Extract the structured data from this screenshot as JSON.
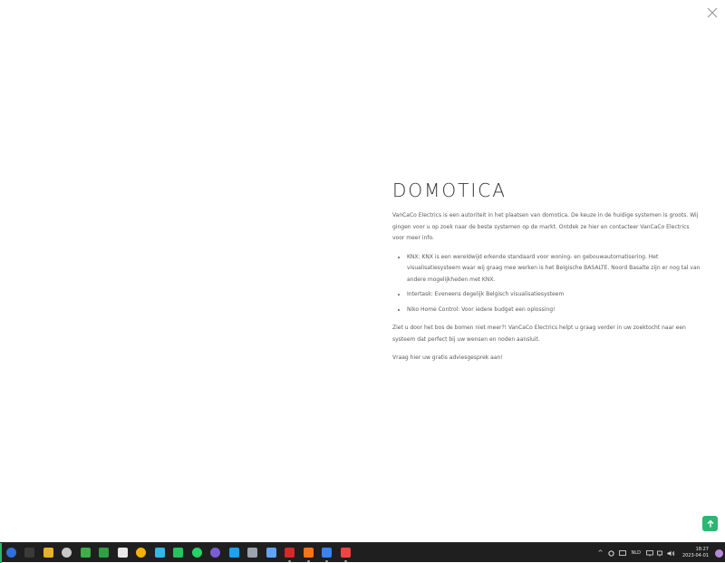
{
  "article": {
    "title": "DOMOTICA",
    "intro": "VanCaCo Electrics is een autoriteit in het plaatsen van domotica. De keuze in de huidige systemen is groots. Wij gingen voor u op zoek naar de beste systemen op de markt. Ontdek ze hier en contacteer VanCaCo Electrics voor meer info.",
    "bullets": [
      "KNX: KNX is een wereldwijd erkende standaard voor woning- en gebouwautomatisering. Het visualisatiesysteem waar wij graag mee werken is het Belgische BASALTE. Noord Basalte zijn er nog tal van andere mogelijkheden met KNX.",
      "Intertask: Eveneens degelijk Belgisch visualisatiesysteem",
      "Niko Home Control: Voor iedere budget een oplossing!"
    ],
    "outro": "Ziet u door het bos de bomen niet meer?! VanCaCo Electrics helpt u graag verder in uw zoektocht naar een systeem dat perfect bij uw wensen en noden aansluit.",
    "cta": "Vraag hier uw gratis adviesgesprek aan!"
  },
  "icons": {
    "close": "close-icon",
    "scroll_top": "arrow-up-icon"
  },
  "colors": {
    "accent": "#2bb673",
    "taskbar": "#1f1f1f"
  },
  "taskbar": {
    "apps": [
      {
        "name": "app-blue-circle",
        "color": "#2e6fd8",
        "shape": "round",
        "running": false
      },
      {
        "name": "app-terminal",
        "color": "#3a3a3a",
        "shape": "square",
        "running": false
      },
      {
        "name": "app-yellow-folder",
        "color": "#e6b325",
        "shape": "square",
        "running": false
      },
      {
        "name": "app-settings",
        "color": "#c7c7c7",
        "shape": "round",
        "running": false
      },
      {
        "name": "app-green-chart",
        "color": "#3fae4a",
        "shape": "square",
        "running": false
      },
      {
        "name": "app-green-tiles",
        "color": "#2f9e44",
        "shape": "square",
        "running": false
      },
      {
        "name": "app-tumblr",
        "color": "#e8e8e8",
        "shape": "square",
        "running": false
      },
      {
        "name": "app-chrome",
        "color": "#f2b400",
        "shape": "round",
        "running": false
      },
      {
        "name": "app-play",
        "color": "#33b6e8",
        "shape": "square",
        "running": false
      },
      {
        "name": "app-green-bolt",
        "color": "#22c55e",
        "shape": "square",
        "running": false
      },
      {
        "name": "app-whatsapp",
        "color": "#25d366",
        "shape": "round",
        "running": false
      },
      {
        "name": "app-purple-circle",
        "color": "#7b5cd6",
        "shape": "round",
        "running": false
      },
      {
        "name": "app-bird",
        "color": "#1da1f2",
        "shape": "square",
        "running": false
      },
      {
        "name": "app-network",
        "color": "#9ca3af",
        "shape": "square",
        "running": false
      },
      {
        "name": "app-tools",
        "color": "#60a5fa",
        "shape": "square",
        "running": false
      },
      {
        "name": "app-filezilla",
        "color": "#d62828",
        "shape": "square",
        "running": true
      },
      {
        "name": "app-xampp",
        "color": "#f97316",
        "shape": "square",
        "running": true
      },
      {
        "name": "app-paint",
        "color": "#3b82f6",
        "shape": "square",
        "running": true
      },
      {
        "name": "app-editor",
        "color": "#ef4444",
        "shape": "square",
        "running": true
      }
    ],
    "tray": {
      "chevron": "^",
      "language": "NLD",
      "time": "18:27",
      "date": "2023-04-01"
    }
  }
}
